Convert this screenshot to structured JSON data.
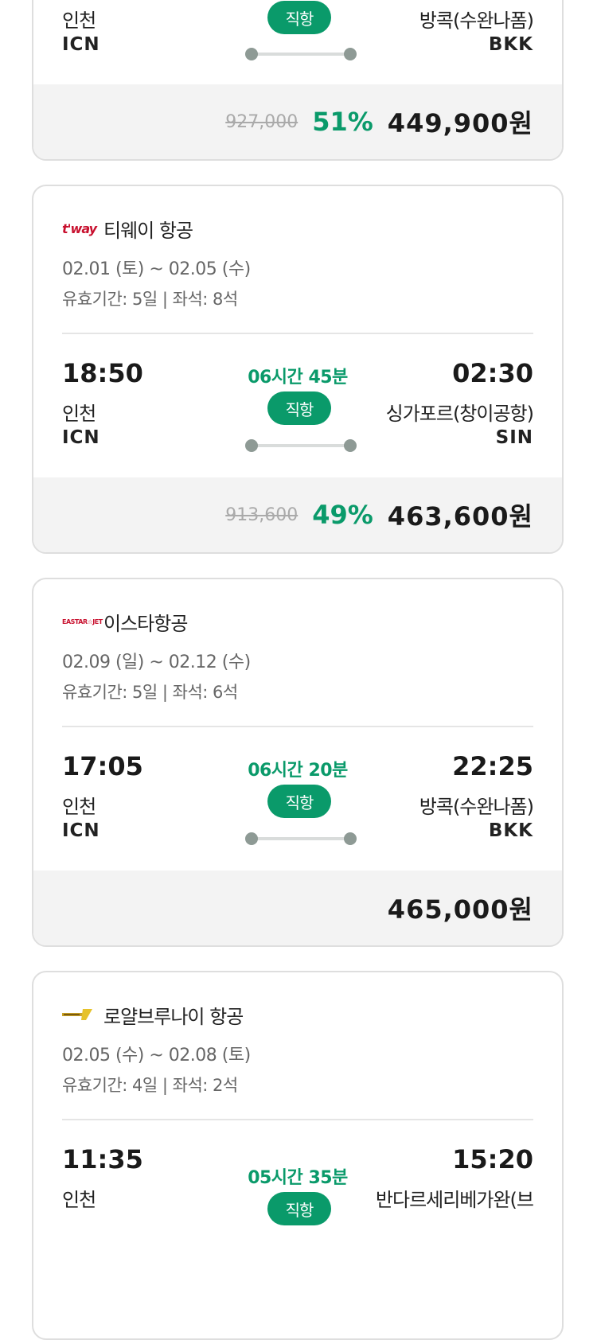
{
  "cards": [
    {
      "airline": "",
      "dates": "",
      "validity": "",
      "dep_time": "",
      "arr_time": "",
      "duration": "",
      "direct_label": "직항",
      "dep_city": "인천",
      "dep_code": "ICN",
      "arr_city": "방콕(수완나폼)",
      "arr_code": "BKK",
      "orig_price": "927,000",
      "discount": "51%",
      "final_price": "449,900원"
    },
    {
      "airline": "티웨이 항공",
      "logo_text": "t'way",
      "dates": "02.01 (토) ~ 02.05 (수)",
      "validity": "유효기간: 5일 | 좌석: 8석",
      "dep_time": "18:50",
      "arr_time": "02:30",
      "duration": "06시간 45분",
      "direct_label": "직항",
      "dep_city": "인천",
      "dep_code": "ICN",
      "arr_city": "싱가포르(창이공항)",
      "arr_code": "SIN",
      "orig_price": "913,600",
      "discount": "49%",
      "final_price": "463,600원"
    },
    {
      "airline": "이스타항공",
      "logo_text": "EASTAR☆JET",
      "dates": "02.09 (일) ~ 02.12 (수)",
      "validity": "유효기간: 5일 | 좌석: 6석",
      "dep_time": "17:05",
      "arr_time": "22:25",
      "duration": "06시간 20분",
      "direct_label": "직항",
      "dep_city": "인천",
      "dep_code": "ICN",
      "arr_city": "방콕(수완나폼)",
      "arr_code": "BKK",
      "orig_price": "",
      "discount": "",
      "final_price": "465,000원"
    },
    {
      "airline": "로얄브루나이 항공",
      "dates": "02.05 (수) ~ 02.08 (토)",
      "validity": "유효기간: 4일 | 좌석: 2석",
      "dep_time": "11:35",
      "arr_time": "15:20",
      "duration": "05시간 35분",
      "direct_label": "직항",
      "dep_city": "인천",
      "arr_city": "반다르세리베가완(브"
    }
  ],
  "colors": {
    "accent": "#0a9a6a",
    "border": "#dedede",
    "price_bar_bg": "#f3f3f3"
  }
}
